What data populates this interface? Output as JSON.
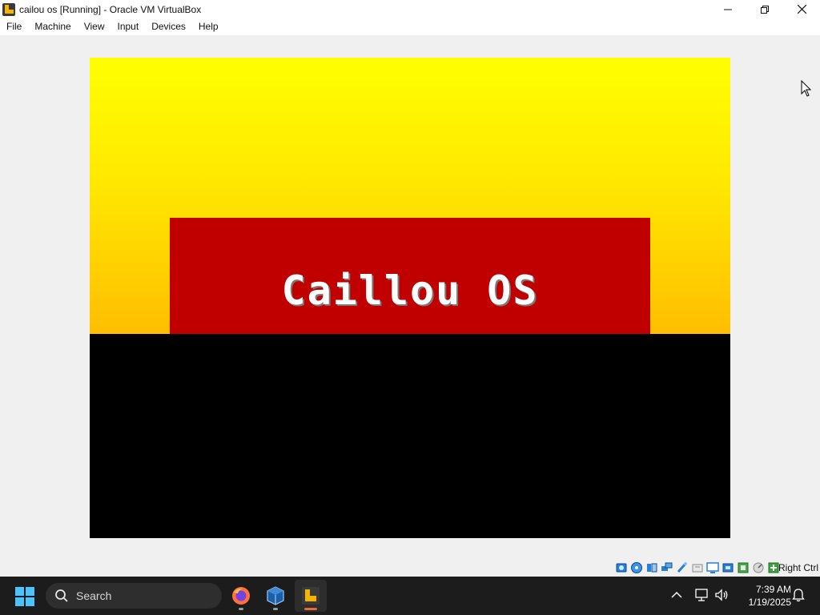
{
  "window": {
    "title": "cailou os [Running] - Oracle VM VirtualBox",
    "controls": [
      "minimize",
      "maximize",
      "close"
    ]
  },
  "menu": {
    "items": [
      "File",
      "Machine",
      "View",
      "Input",
      "Devices",
      "Help"
    ]
  },
  "vm_screen": {
    "title": "Caillou OS",
    "colors": {
      "sky_top": "#ffff00",
      "sky_bottom": "#ffbe00",
      "banner": "#c00000",
      "ground": "#000000",
      "text": "#ffffff"
    }
  },
  "statusbar": {
    "icons": [
      "hard-disk-icon",
      "optical-drive-icon",
      "audio-icon",
      "network-icon",
      "usb-icon",
      "shared-folders-icon",
      "display-icon",
      "video-capture-icon",
      "recording-icon",
      "cpu-icon",
      "mouse-integration-icon",
      "host-key-icon"
    ],
    "host_key": "Right Ctrl"
  },
  "taskbar": {
    "search_label": "Search",
    "apps": [
      {
        "name": "firefox-icon",
        "active": false
      },
      {
        "name": "virtualbox-icon",
        "active": false
      },
      {
        "name": "caillou-os-vm-icon",
        "active": true
      }
    ],
    "clock": {
      "time": "7:39 AM",
      "date": "1/19/2025"
    }
  }
}
